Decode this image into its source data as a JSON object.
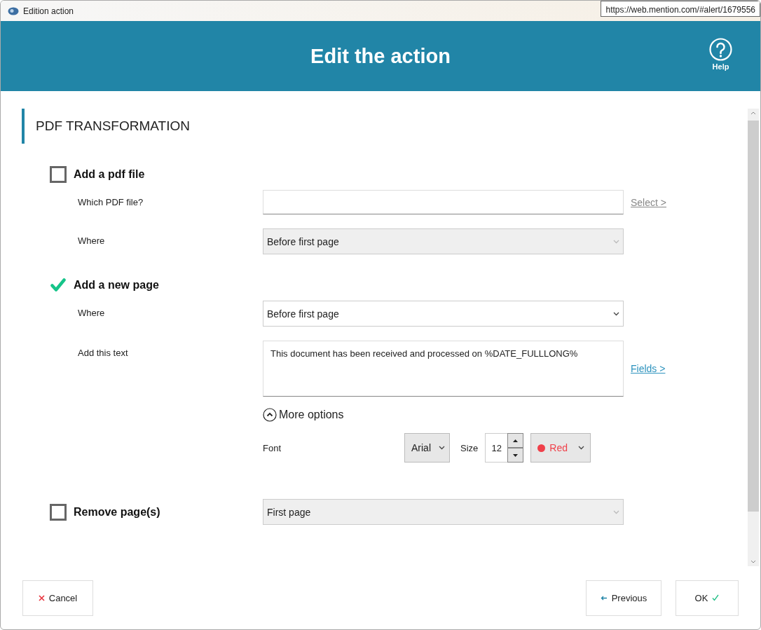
{
  "window": {
    "title": "Edition action"
  },
  "tooltip": {
    "text": "https://web.mention.com/#alert/1679556"
  },
  "header": {
    "title": "Edit the action",
    "help": "Help"
  },
  "section": {
    "title": "PDF TRANSFORMATION"
  },
  "options": [
    {
      "label": "Add a pdf file",
      "checked": false,
      "fields": [
        {
          "kind": "input",
          "label": "Which PDF file?",
          "link": {
            "text": "Select >",
            "disabled": true
          }
        },
        {
          "kind": "select",
          "label": "Where",
          "value": "Before first page",
          "disabled": true
        }
      ]
    },
    {
      "label": "Add a new page",
      "checked": true,
      "fields": [
        {
          "kind": "select",
          "label": "Where",
          "value": "Before first page",
          "disabled": false
        },
        {
          "kind": "textarea",
          "label": "Add this text",
          "value": "This document has been received and processed on %DATE_FULLLONG%",
          "link": {
            "text": "Fields >",
            "disabled": false
          }
        }
      ],
      "more_options": {
        "label": "More options",
        "expanded": true,
        "font_label": "Font",
        "font": "Arial",
        "size_label": "Size",
        "size": "12",
        "color_name": "Red",
        "color": "#f0404a"
      }
    },
    {
      "label": "Remove page(s)",
      "checked": false,
      "select": {
        "value": "First page",
        "disabled": true
      }
    }
  ],
  "footer": {
    "cancel": "Cancel",
    "previous": "Previous",
    "ok": "OK"
  }
}
